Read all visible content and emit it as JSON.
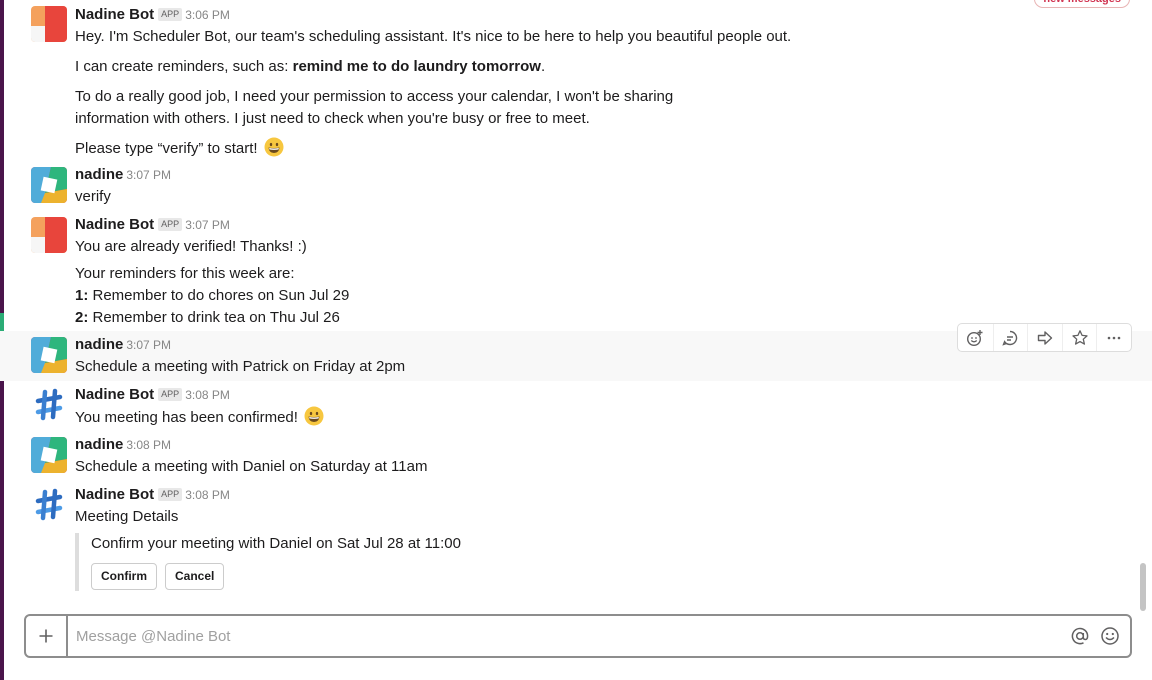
{
  "new_messages_label": "new messages",
  "app_badge": "APP",
  "messages": [
    {
      "sender": "Nadine Bot",
      "is_app": true,
      "time": "3:06 PM",
      "lines": [
        {
          "text": "Hey. I'm Scheduler Bot, our team's scheduling assistant. It's nice to be here to help you beautiful people out."
        },
        {
          "before": "I can create reminders, such as: ",
          "bold": "remind me to do laundry tomorrow",
          "after": "."
        },
        {
          "text": "To do a really good job, I need your permission to access your calendar, I won't be sharing"
        },
        {
          "text": "information with others. I just need to check when you're busy or free to meet."
        },
        {
          "text": "Please type “verify” to start!",
          "emoji": "grinning-emoji"
        }
      ]
    },
    {
      "sender": "nadine",
      "time": "3:07 PM",
      "lines": [
        {
          "text": "verify"
        }
      ]
    },
    {
      "sender": "Nadine Bot",
      "is_app": true,
      "time": "3:07 PM",
      "lines": [
        {
          "text": "You are already verified! Thanks! :)"
        },
        {
          "text": "Your reminders for this week are:"
        },
        {
          "num": "1:",
          "text": " Remember to do chores on Sun Jul 29"
        },
        {
          "num": "2:",
          "text": " Remember to drink tea on Thu Jul 26"
        }
      ]
    },
    {
      "sender": "nadine",
      "time": "3:07 PM",
      "lines": [
        {
          "text": "Schedule a meeting with Patrick on Friday at 2pm"
        }
      ]
    },
    {
      "sender": "Nadine Bot",
      "is_app": true,
      "time": "3:08 PM",
      "lines": [
        {
          "text": "You meeting has been confirmed!",
          "emoji": "grinning-emoji"
        }
      ]
    },
    {
      "sender": "nadine",
      "time": "3:08 PM",
      "lines": [
        {
          "text": "Schedule a meeting with Daniel on Saturday at 11am"
        }
      ]
    },
    {
      "sender": "Nadine Bot",
      "is_app": true,
      "time": "3:08 PM",
      "lines": [
        {
          "text": "Meeting Details"
        }
      ],
      "attachment": {
        "text": "Confirm your meeting with Daniel on Sat Jul 28 at 11:00",
        "confirm_label": "Confirm",
        "cancel_label": "Cancel"
      }
    }
  ],
  "message_actions": [
    "add-reaction-icon",
    "start-thread-icon",
    "share-message-icon",
    "star-icon",
    "more-actions-icon"
  ],
  "composer": {
    "placeholder": "Message @Nadine Bot",
    "value": ""
  },
  "colors": {
    "sidebar": "#4a154b",
    "unread_marker": "#2bac76",
    "new_messages": "#d0324f",
    "hover_row": "#f8f8f8"
  }
}
